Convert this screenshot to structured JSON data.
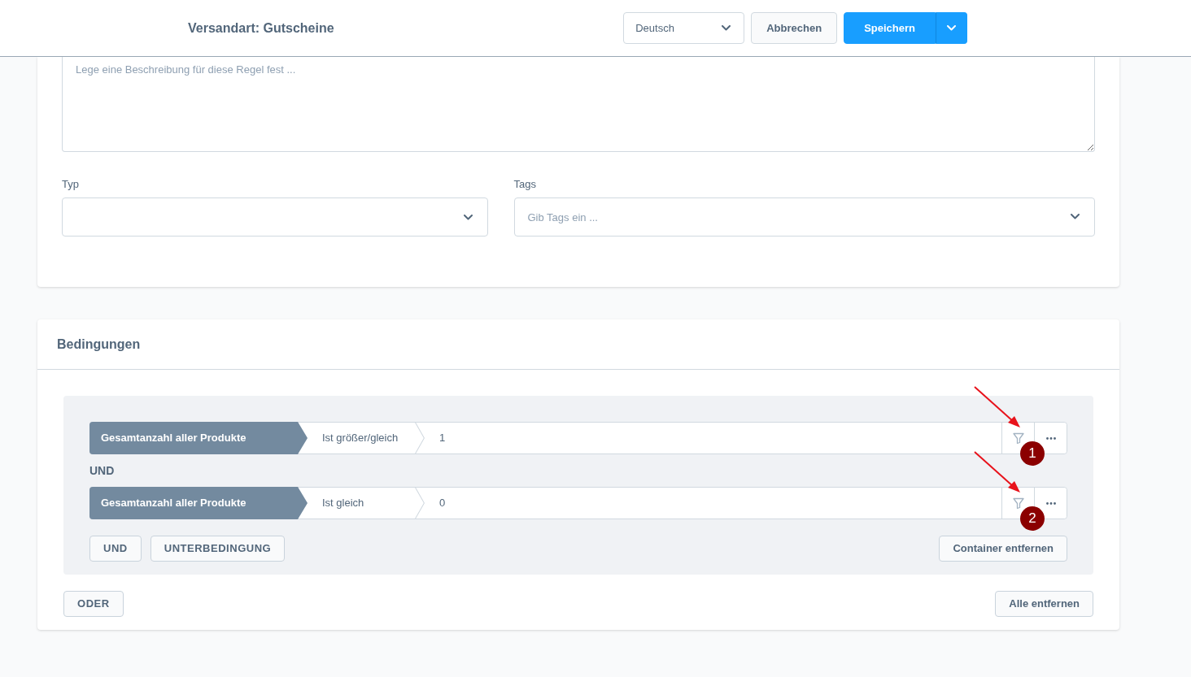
{
  "header": {
    "title": "Versandart: Gutscheine",
    "language_select": {
      "value": "Deutsch"
    },
    "buttons": [
      {
        "label": "Abbrechen",
        "kind": "secondary"
      },
      {
        "label": "Speichern",
        "kind": "primary"
      }
    ]
  },
  "rule_form": {
    "description": {
      "placeholder": "Lege eine Beschreibung für diese Regel fest ..."
    },
    "type": {
      "label": "Typ"
    },
    "tags": {
      "label": "Tags",
      "placeholder": "Gib Tags ein ..."
    }
  },
  "conditions_card": {
    "title": "Bedingungen",
    "group": {
      "conditions": [
        {
          "field": "Gesamtanzahl aller Produkte",
          "operator": "Ist größer/gleich",
          "value": "1",
          "callout": "1"
        },
        {
          "field": "Gesamtanzahl aller Produkte",
          "operator": "Ist gleich",
          "value": "0",
          "callout": "2"
        }
      ],
      "connector": "UND",
      "buttons": [
        "UND",
        "UNTERBEDINGUNG"
      ],
      "remove_button": "Container entfernen"
    },
    "or_button": "ODER",
    "remove_all_button": "Alle entfernen"
  }
}
